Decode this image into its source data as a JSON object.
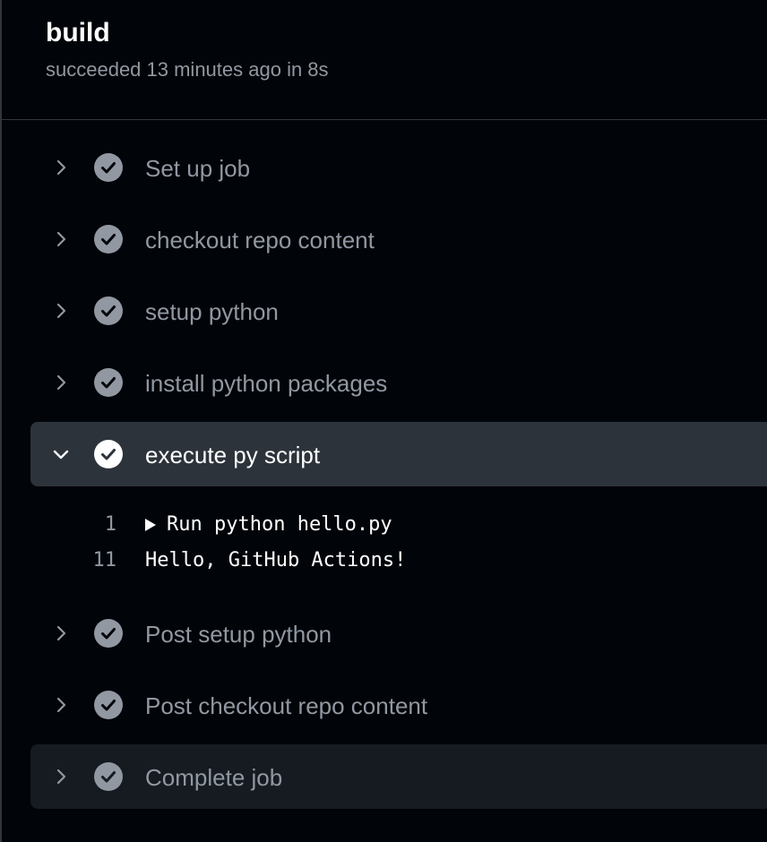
{
  "job": {
    "title": "build",
    "status": "succeeded 13 minutes ago in 8s"
  },
  "colors": {
    "background": "#010409",
    "expanded_row": "#2d333b",
    "hover_row": "#161b22",
    "muted_text": "#9198a1",
    "check_fill": "#9198a1",
    "check_fill_active": "#ffffff"
  },
  "steps": [
    {
      "label": "Set up job",
      "status": "success",
      "icon": "check-circle-icon"
    },
    {
      "label": "checkout repo content",
      "status": "success",
      "icon": "check-circle-icon"
    },
    {
      "label": "setup python",
      "status": "success",
      "icon": "check-circle-icon"
    },
    {
      "label": "install python packages",
      "status": "success",
      "icon": "check-circle-icon"
    },
    {
      "label": "execute py script",
      "status": "success",
      "icon": "check-circle-icon",
      "expanded": true,
      "log": [
        {
          "line": "1",
          "text": "Run python hello.py",
          "collapsible": true
        },
        {
          "line": "11",
          "text": "Hello, GitHub Actions!"
        }
      ]
    },
    {
      "label": "Post setup python",
      "status": "success",
      "icon": "check-circle-icon"
    },
    {
      "label": "Post checkout repo content",
      "status": "success",
      "icon": "check-circle-icon"
    },
    {
      "label": "Complete job",
      "status": "success",
      "icon": "check-circle-icon",
      "hovered": true
    }
  ]
}
